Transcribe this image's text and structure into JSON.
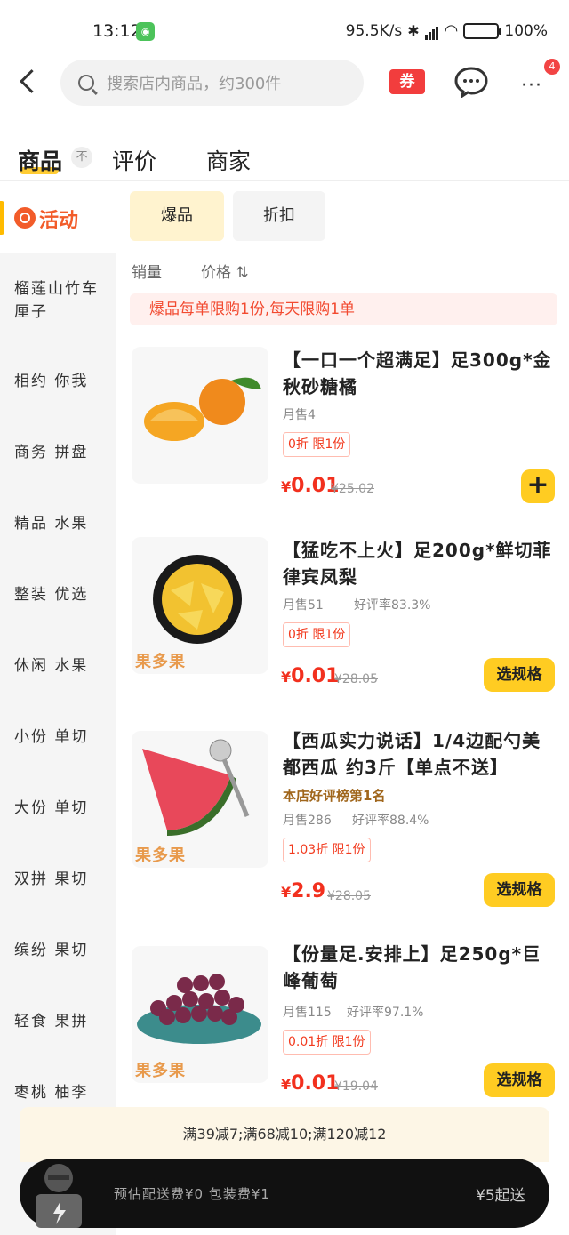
{
  "status": {
    "time": "13:12",
    "net_speed": "95.5K/s",
    "battery_text": "100%",
    "battery_level": 1.0
  },
  "header": {
    "search_placeholder": "搜索店内商品，约300件",
    "coupon_label": "券",
    "more_label": "···",
    "badge_count": "4"
  },
  "tabs": [
    {
      "label": "商品",
      "active": true
    },
    {
      "label": "评价",
      "active": false
    },
    {
      "label": "商家",
      "active": false
    }
  ],
  "tab_mark": "不",
  "sidebar": {
    "active_label": "活动",
    "items": [
      {
        "label": "榴莲山竹车厘子"
      },
      {
        "label": "相约 你我"
      },
      {
        "label": "商务 拼盘"
      },
      {
        "label": "精品 水果"
      },
      {
        "label": "整装 优选"
      },
      {
        "label": "休闲 水果"
      },
      {
        "label": "小份 单切"
      },
      {
        "label": "大份 单切"
      },
      {
        "label": "双拼 果切"
      },
      {
        "label": "缤纷 果切"
      },
      {
        "label": "轻食 果拼"
      },
      {
        "label": "枣桃 柚李"
      }
    ]
  },
  "filters": {
    "hot": "爆品",
    "discount": "折扣"
  },
  "sort": {
    "sales": "销量",
    "price": "价格 ⇅"
  },
  "limit_banner": "爆品每单限购1份,每天限购1单",
  "products": [
    {
      "title": "【一口一个超满足】足300g*金秋砂糖橘",
      "rank": "",
      "sales": "月售4",
      "rating": "",
      "tag": "0折 限1份",
      "price": "0.01",
      "currency": "¥",
      "orig_price": "¥25.02",
      "button": "+"
    },
    {
      "title": "【猛吃不上火】足200g*鲜切菲律宾凤梨",
      "rank": "",
      "sales": "月售51",
      "rating": "好评率83.3%",
      "tag": "0折 限1份",
      "price": "0.01",
      "currency": "¥",
      "orig_price": "¥28.05",
      "button": "选规格",
      "brand": "果多果"
    },
    {
      "title": "【西瓜实力说话】1/4边配勺美都西瓜 约3斤【单点不送】",
      "rank": "本店好评榜第1名",
      "sales": "月售286",
      "rating": "好评率88.4%",
      "tag": "1.03折 限1份",
      "price": "2.9",
      "currency": "¥",
      "orig_price": "¥28.05",
      "button": "选规格",
      "brand": "果多果"
    },
    {
      "title": "【份量足.安排上】足250g*巨峰葡萄",
      "rank": "",
      "sales": "月售115",
      "rating": "好评率97.1%",
      "tag": "0.01折 限1份",
      "price": "0.01",
      "currency": "¥",
      "orig_price": "¥19.04",
      "button": "选规格",
      "brand": "果多果"
    }
  ],
  "bottom": {
    "promo": "满39减7;满68减10;满120减12",
    "delivery": "预估配送费¥0 包装费¥1",
    "min_order": "¥5起送"
  },
  "colors": {
    "accent": "#ffcc22",
    "price": "#f2301e",
    "activity": "#f25c2a"
  }
}
